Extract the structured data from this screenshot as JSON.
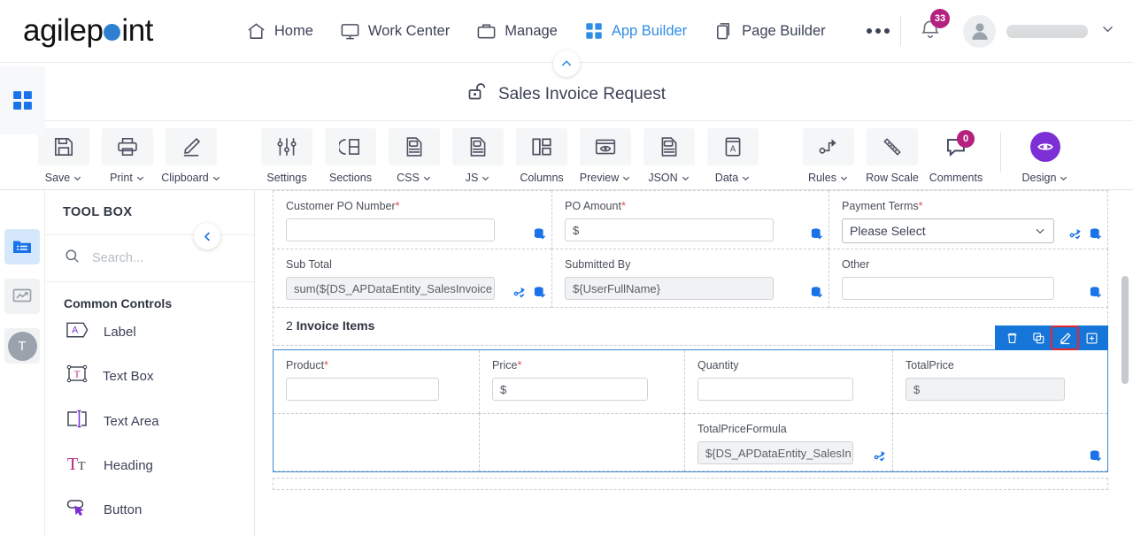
{
  "header": {
    "logo_text_a": "agilep",
    "logo_text_b": "int",
    "nav": [
      {
        "label": "Home",
        "icon": "home-icon",
        "active": false
      },
      {
        "label": "Work Center",
        "icon": "monitor-icon",
        "active": false
      },
      {
        "label": "Manage",
        "icon": "briefcase-icon",
        "active": false
      },
      {
        "label": "App Builder",
        "icon": "grid-icon",
        "active": true
      },
      {
        "label": "Page Builder",
        "icon": "page-icon",
        "active": false
      }
    ],
    "more_label": "more-options",
    "notification_count": "33",
    "user_name": ""
  },
  "title_bar": {
    "title": "Sales Invoice Request",
    "lock_icon": "unlock-icon",
    "collapse_icon": "chevron-up-icon"
  },
  "toolbar": {
    "items": [
      {
        "label": "Save",
        "icon": "floppy-disk-icon",
        "caret": true,
        "badge": null
      },
      {
        "label": "Print",
        "icon": "printer-icon",
        "caret": true,
        "badge": null
      },
      {
        "label": "Clipboard",
        "icon": "pencil-icon",
        "caret": true,
        "badge": null
      },
      {
        "label": "Settings",
        "icon": "sliders-icon",
        "caret": false,
        "badge": null
      },
      {
        "label": "Sections",
        "icon": "sections-icon",
        "caret": false,
        "badge": null
      },
      {
        "label": "CSS",
        "icon": "css-file-icon",
        "caret": true,
        "badge": null
      },
      {
        "label": "JS",
        "icon": "js-file-icon",
        "caret": true,
        "badge": null
      },
      {
        "label": "Columns",
        "icon": "columns-icon",
        "caret": false,
        "badge": null
      },
      {
        "label": "Preview",
        "icon": "eye-window-icon",
        "caret": true,
        "badge": null
      },
      {
        "label": "JSON",
        "icon": "json-file-icon",
        "caret": true,
        "badge": null
      },
      {
        "label": "Data",
        "icon": "data-book-icon",
        "caret": true,
        "badge": null
      },
      {
        "label": "Rules",
        "icon": "rules-flow-icon",
        "caret": true,
        "badge": null
      },
      {
        "label": "Row Scale",
        "icon": "ruler-icon",
        "caret": false,
        "badge": null
      },
      {
        "label": "Comments",
        "icon": "comment-icon",
        "caret": false,
        "badge": "0"
      }
    ],
    "design": {
      "label": "Design",
      "icon": "eye-icon",
      "caret": true
    }
  },
  "rail": {
    "items": [
      {
        "name": "apps-grid-icon",
        "state": "blue"
      },
      {
        "name": "folder-list-icon",
        "state": "active"
      },
      {
        "name": "chart-icon",
        "state": "soft"
      },
      {
        "name": "user-initial",
        "state": "avatar",
        "text": "T"
      }
    ]
  },
  "toolbox": {
    "heading": "TOOL BOX",
    "search_placeholder": "Search...",
    "group_title": "Common Controls",
    "items": [
      {
        "label": "Label",
        "icon": "label-tag-icon"
      },
      {
        "label": "Text Box",
        "icon": "textbox-icon"
      },
      {
        "label": "Text Area",
        "icon": "textarea-icon"
      },
      {
        "label": "Heading",
        "icon": "heading-icon"
      },
      {
        "label": "Button",
        "icon": "button-icon"
      }
    ],
    "collapse_icon": "chevron-left-icon"
  },
  "form": {
    "row1": [
      {
        "label": "Customer PO Number",
        "required": true,
        "value": "",
        "type": "text",
        "icons": [
          "data-binding-icon"
        ]
      },
      {
        "label": "PO Amount",
        "required": true,
        "value": "$",
        "type": "text",
        "icons": [
          "data-binding-icon"
        ]
      },
      {
        "label": "Payment Terms",
        "required": true,
        "value": "Please Select",
        "type": "select",
        "icons": [
          "rules-icon",
          "data-binding-icon"
        ]
      }
    ],
    "row2": [
      {
        "label": "Sub Total",
        "required": false,
        "type": "readonly",
        "value": "sum(${DS_APDataEntity_SalesInvoice",
        "icons": [
          "rules-icon",
          "data-binding-icon"
        ]
      },
      {
        "label": "Submitted By",
        "required": false,
        "type": "readonly",
        "value": "${UserFullName}",
        "icons": [
          "data-binding-icon"
        ]
      },
      {
        "label": "Other",
        "required": false,
        "type": "text",
        "value": "",
        "icons": [
          "data-binding-icon"
        ]
      }
    ],
    "section": {
      "number": "2",
      "title": "Invoice Items"
    },
    "item_row1": [
      {
        "label": "Product",
        "required": true,
        "value": "",
        "type": "text",
        "icons": []
      },
      {
        "label": "Price",
        "required": true,
        "value": "$",
        "type": "text",
        "icons": []
      },
      {
        "label": "Quantity",
        "required": false,
        "value": "",
        "type": "text",
        "icons": []
      },
      {
        "label": "TotalPrice",
        "required": false,
        "value": "$",
        "type": "readonly",
        "icons": []
      }
    ],
    "item_row2": [
      {
        "label": "",
        "required": false,
        "value": "",
        "type": "empty",
        "icons": []
      },
      {
        "label": "",
        "required": false,
        "value": "",
        "type": "empty",
        "icons": []
      },
      {
        "label": "TotalPriceFormula",
        "required": false,
        "type": "readonly",
        "value": "${DS_APDataEntity_SalesIn",
        "icons": [
          "rules-icon"
        ]
      },
      {
        "label": "",
        "required": false,
        "value": "",
        "type": "empty",
        "icons": [
          "data-binding-icon"
        ]
      }
    ],
    "actions": [
      {
        "name": "delete-row-button",
        "icon": "trash-icon",
        "highlighted": false
      },
      {
        "name": "copy-row-button",
        "icon": "copy-icon",
        "highlighted": false
      },
      {
        "name": "edit-row-button",
        "icon": "pencil-icon",
        "highlighted": true
      },
      {
        "name": "duplicate-row-button",
        "icon": "duplicate-icon",
        "highlighted": false
      }
    ]
  },
  "colors": {
    "accent_blue": "#2f8de4",
    "selection_blue": "#1575d8",
    "badge_magenta": "#b5217f",
    "design_purple": "#7b2fd4",
    "highlight_red": "#e8262a",
    "required_red": "#d9534f"
  }
}
